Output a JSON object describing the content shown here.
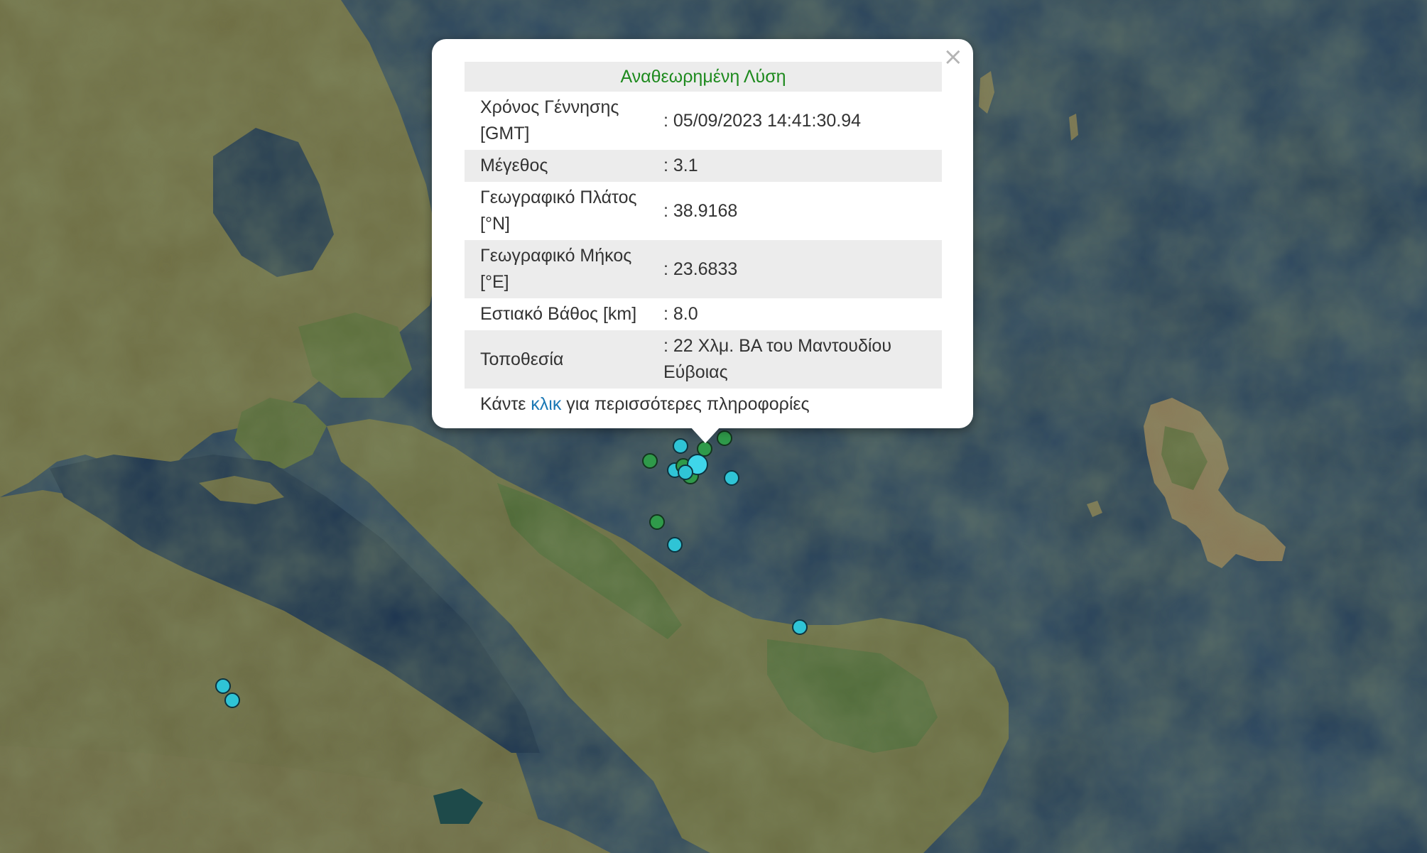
{
  "popup": {
    "close_symbol": "×",
    "heading": "Αναθεωρημένη Λύση",
    "rows": [
      {
        "label": "Χρόνος Γέννησης [GMT]",
        "value": ": 05/09/2023 14:41:30.94"
      },
      {
        "label": "Μέγεθος",
        "value": ": 3.1"
      },
      {
        "label": "Γεωγραφικό Πλάτος [°N]",
        "value": ": 38.9168"
      },
      {
        "label": "Γεωγραφικό Μήκος [°E]",
        "value": ": 23.6833"
      },
      {
        "label": "Εστιακό Βάθος [km]",
        "value": ": 8.0"
      },
      {
        "label": "Τοποθεσία",
        "value": ": 22 Χλμ. ΒΑ του Μαντουδίου Εύβοιας"
      }
    ],
    "footer_before": "Κάντε ",
    "footer_link": "κλικ",
    "footer_after": " για περισσότερες πληροφορίες"
  },
  "colors": {
    "sea": "#1d3550",
    "land": "#6b6a45",
    "marker_cyan": "#2fc4d6",
    "marker_green": "#2f9a4a",
    "heading_green": "#1e8a1e",
    "link_blue": "#1a78b5"
  }
}
